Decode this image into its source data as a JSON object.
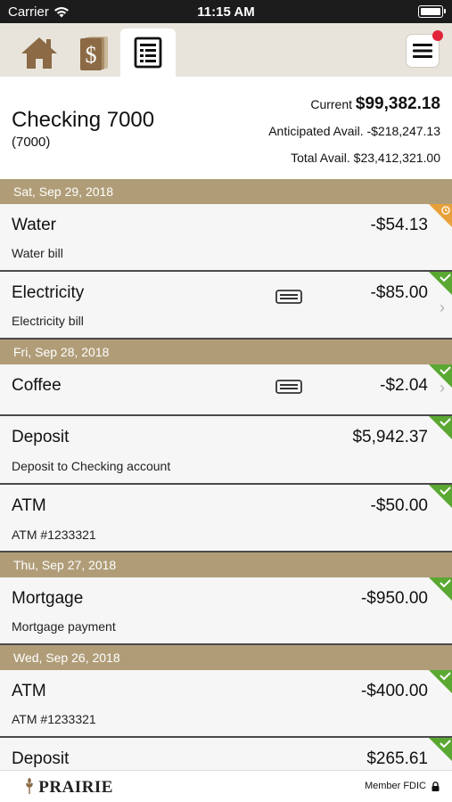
{
  "status_bar": {
    "carrier": "Carrier",
    "time": "11:15 AM"
  },
  "nav": {
    "tabs": [
      {
        "name": "home-icon"
      },
      {
        "name": "dollar-book-icon"
      },
      {
        "name": "register-icon",
        "active": true
      }
    ],
    "has_notification": true
  },
  "account": {
    "name": "Checking 7000",
    "number": "(7000)",
    "current_label": "Current",
    "current_value": "$99,382.18",
    "anticipated": "Anticipated Avail. -$218,247.13",
    "total": "Total Avail. $23,412,321.00"
  },
  "groups": [
    {
      "date": "Sat, Sep 29, 2018",
      "txns": [
        {
          "title": "Water",
          "desc": "Water bill",
          "amount": "-$54.13",
          "status": "pending",
          "card": false,
          "chevron": false
        },
        {
          "title": "Electricity",
          "desc": "Electricity bill",
          "amount": "-$85.00",
          "status": "cleared",
          "card": true,
          "chevron": true
        }
      ]
    },
    {
      "date": "Fri, Sep 28, 2018",
      "txns": [
        {
          "title": "Coffee",
          "desc": "",
          "amount": "-$2.04",
          "status": "cleared",
          "card": true,
          "chevron": true
        },
        {
          "title": "Deposit",
          "desc": "Deposit to Checking account",
          "amount": "$5,942.37",
          "status": "cleared",
          "card": false,
          "chevron": false
        },
        {
          "title": "ATM",
          "desc": "ATM #1233321",
          "amount": "-$50.00",
          "status": "cleared",
          "card": false,
          "chevron": false
        }
      ]
    },
    {
      "date": "Thu, Sep 27, 2018",
      "txns": [
        {
          "title": "Mortgage",
          "desc": "Mortgage payment",
          "amount": "-$950.00",
          "status": "cleared",
          "card": false,
          "chevron": false
        }
      ]
    },
    {
      "date": "Wed, Sep 26, 2018",
      "txns": [
        {
          "title": "ATM",
          "desc": "ATM #1233321",
          "amount": "-$400.00",
          "status": "cleared",
          "card": false,
          "chevron": false
        },
        {
          "title": "Deposit",
          "desc": "",
          "amount": "$265.61",
          "status": "cleared",
          "card": false,
          "chevron": false
        }
      ]
    }
  ],
  "footer": {
    "logo": "PRAIRIE",
    "fdic": "Member FDIC"
  },
  "colors": {
    "date_header": "#b09d78",
    "cleared": "#5aa832",
    "pending": "#e8a13a",
    "notification": "#e0243a"
  }
}
